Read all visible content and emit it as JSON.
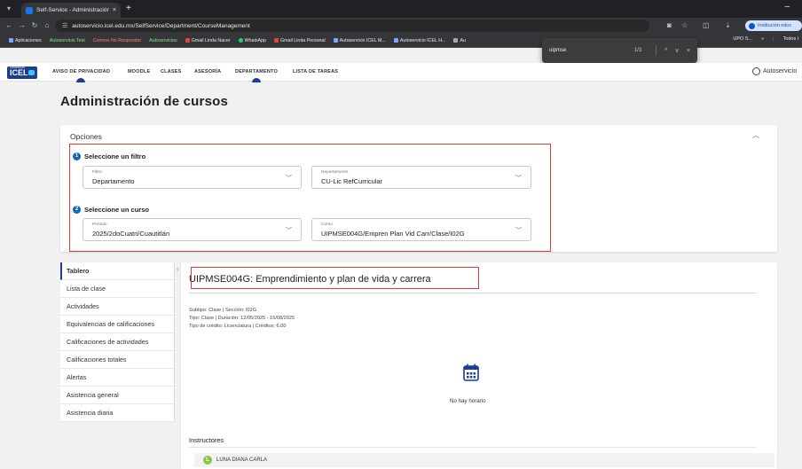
{
  "browser": {
    "tab_title": "Self-Service - Administración c",
    "tab_close": "×",
    "new_tab": "+",
    "window_min": "–",
    "url": "autoservicio.icel.edu.mx/SelfService/Department/CourseManagement",
    "profile_label": "Institución educ"
  },
  "bookmarks": {
    "items": [
      {
        "label": "Aplicaciones",
        "style": "plain"
      },
      {
        "label": "Autoservicio Test",
        "style": "green"
      },
      {
        "label": "Correos No Responder",
        "style": "red"
      },
      {
        "label": "Autoservicios",
        "style": "green"
      },
      {
        "label": "Gmail Linda Nacer",
        "style": "gmail"
      },
      {
        "label": "WhatsApp",
        "style": "whatsapp"
      },
      {
        "label": "Gmail Linda Personal",
        "style": "gmail"
      },
      {
        "label": "Autoservicio ICEL M...",
        "style": "site"
      },
      {
        "label": "Autoservicio ICEL H...",
        "style": "site"
      },
      {
        "label": "Au",
        "style": "square"
      }
    ],
    "partial_right": "UPO S...",
    "more": "»",
    "all_bookmarks": "Todos l"
  },
  "findbar": {
    "query": "uipmse",
    "count": "1/3",
    "up": "^",
    "down": "v",
    "close": "×"
  },
  "nav": {
    "logo_text": "ICEL",
    "logo_small": "UNIVERSIDAD",
    "items": [
      "AVISO DE PRIVACIDAD",
      "MOODLE",
      "CLASES",
      "ASESORÍA",
      "DEPARTAMENTO",
      "LISTA DE TAREAS"
    ],
    "user_label": "Autoservicio"
  },
  "page": {
    "title": "Administración de cursos"
  },
  "options": {
    "title": "Opciones",
    "step1": {
      "num": "1",
      "label": "Seleccione un filtro"
    },
    "step2": {
      "num": "2",
      "label": "Seleccione un curso"
    },
    "filtro": {
      "label": "Filtro",
      "value": "Departamento"
    },
    "departamento": {
      "label": "Departamento",
      "value": "CU-Lic RefCurricular"
    },
    "periodo": {
      "label": "Periodo",
      "value": "2025/2doCuatri/Cuautitlán"
    },
    "curso": {
      "label": "Curso",
      "value": "UIPMSE004G/Empren Plan Vid Carr/Clase/I02G"
    }
  },
  "sidebar": {
    "items": [
      "Tablero",
      "Lista de clase",
      "Actividades",
      "Equivalencias de calificaciones",
      "Calificaciones de actividades",
      "Calificaciones totales",
      "Alertas",
      "Asistencia general",
      "Asistencia diaria"
    ]
  },
  "course": {
    "title": "UIPMSE004G: Emprendimiento y plan de vida y carrera",
    "subtype": "Subtipo: Clase | Sección: I02G",
    "type": "Tipo: Clase | Duración: 12/05/2025 - 15/08/2025",
    "credit": "Tipo de crédito: Licenciatura | Créditos: 6.00",
    "no_schedule": "No hay horario",
    "instructors_title": "Instructores",
    "instructor_initial": "L",
    "instructor_name": "LUNA DIANA CARLA"
  },
  "colors": {
    "brand": "#1e3d8f",
    "highlight": "#e53935",
    "step_badge": "#1565c0"
  }
}
